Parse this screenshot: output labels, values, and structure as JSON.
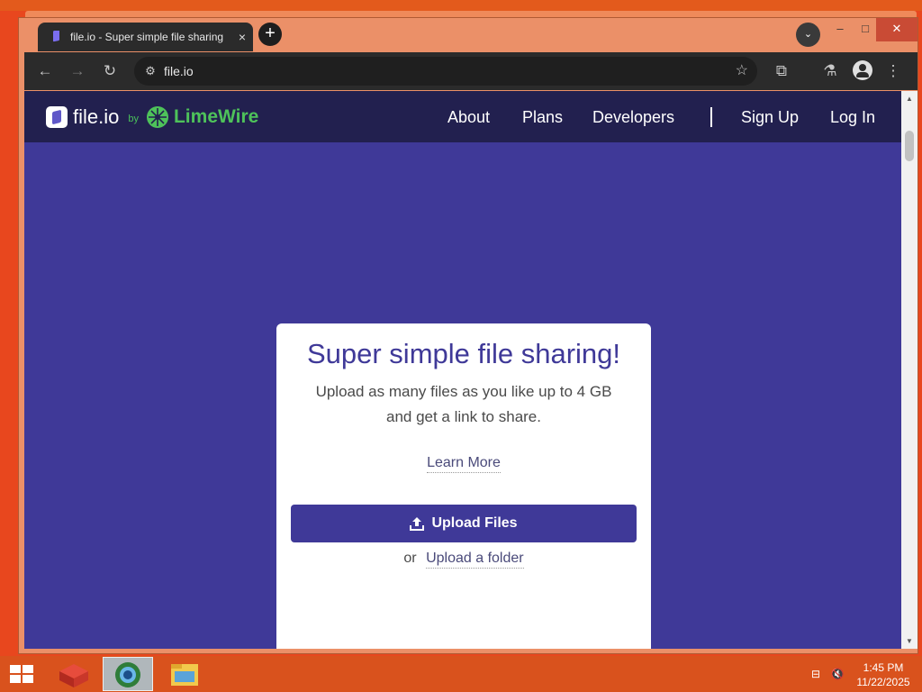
{
  "browser": {
    "tab": {
      "title": "file.io - Super simple file sharing",
      "close_icon": "×"
    },
    "new_tab_icon": "+",
    "tab_search_icon": "⌄",
    "window_controls": {
      "minimize": "–",
      "maximize": "□",
      "close": "✕"
    },
    "toolbar": {
      "back": "←",
      "forward": "→",
      "reload": "↻",
      "url": "file.io",
      "star": "☆",
      "extensions": "⧉",
      "labs": "⚗",
      "menu": "⋮"
    }
  },
  "site": {
    "logo_text": "file.io",
    "by_label": "by",
    "partner": "LimeWire",
    "nav": [
      "About",
      "Plans",
      "Developers",
      "Sign Up",
      "Log In"
    ],
    "card": {
      "title": "Super simple file sharing!",
      "subtitle_line1": "Upload as many files as you like up to 4 GB",
      "subtitle_line2": "and get a link to share.",
      "learn_more": "Learn More",
      "upload_button": "Upload Files",
      "or_label": "or",
      "upload_folder": "Upload a folder"
    }
  },
  "colors": {
    "brand_purple": "#3f3998",
    "nav_dark": "#22204f",
    "lime_green": "#4ec25a"
  },
  "taskbar": {
    "items": [
      "start-icon",
      "package-icon",
      "chrome-icon",
      "file-explorer-icon"
    ],
    "clock_time": "1:45 PM",
    "clock_date": "11/22/2025"
  }
}
